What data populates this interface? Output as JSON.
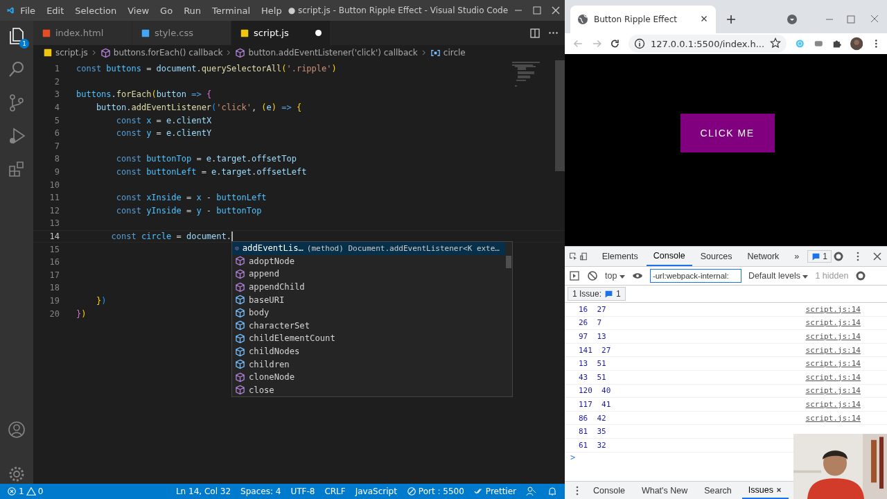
{
  "vscode": {
    "menu": [
      "File",
      "Edit",
      "Selection",
      "View",
      "Go",
      "Run",
      "Terminal",
      "Help"
    ],
    "title": "● script.js - Button Ripple Effect - Visual Studio Code",
    "explorer_badge": "1",
    "tabs": [
      {
        "label": "index.html",
        "kind": "html",
        "selected": false,
        "dirty": false
      },
      {
        "label": "style.css",
        "kind": "css",
        "selected": false,
        "dirty": false
      },
      {
        "label": "script.js",
        "kind": "js",
        "selected": true,
        "dirty": true
      }
    ],
    "breadcrumb": [
      {
        "label": "script.js",
        "kind": "file"
      },
      {
        "label": "buttons.forEach() callback",
        "kind": "method"
      },
      {
        "label": "button.addEventListener('click') callback",
        "kind": "method"
      },
      {
        "label": "circle",
        "kind": "variable"
      }
    ],
    "lines": [
      {
        "number": "1",
        "current": false,
        "tokens": [
          {
            "text": "const",
            "kind": "keyword"
          },
          {
            "text": " buttons",
            "kind": "constant"
          },
          {
            "text": " = ",
            "kind": "plain"
          },
          {
            "text": "document",
            "kind": "variable"
          },
          {
            "text": ".",
            "kind": "plain"
          },
          {
            "text": "querySelectorAll",
            "kind": "function"
          },
          {
            "text": "(",
            "kind": "bracket1"
          },
          {
            "text": "'.ripple'",
            "kind": "string"
          },
          {
            "text": ")",
            "kind": "bracket1"
          }
        ]
      },
      {
        "number": "2",
        "current": false
      },
      {
        "number": "3",
        "current": false,
        "tokens": [
          {
            "text": "buttons",
            "kind": "constant"
          },
          {
            "text": ".",
            "kind": "plain"
          },
          {
            "text": "forEach",
            "kind": "function"
          },
          {
            "text": "(",
            "kind": "bracket1"
          },
          {
            "text": "button",
            "kind": "variable"
          },
          {
            "text": " => ",
            "kind": "keyword"
          },
          {
            "text": "{",
            "kind": "bracket2"
          }
        ]
      },
      {
        "number": "4",
        "current": false,
        "tokens": [
          {
            "text": "    button",
            "kind": "variable"
          },
          {
            "text": ".",
            "kind": "plain"
          },
          {
            "text": "addEventListener",
            "kind": "function"
          },
          {
            "text": "(",
            "kind": "bracket3"
          },
          {
            "text": "'click'",
            "kind": "string"
          },
          {
            "text": ", ",
            "kind": "plain"
          },
          {
            "text": "(",
            "kind": "bracket1"
          },
          {
            "text": "e",
            "kind": "variable"
          },
          {
            "text": ")",
            "kind": "bracket1"
          },
          {
            "text": " => ",
            "kind": "keyword"
          },
          {
            "text": "{",
            "kind": "bracket1"
          }
        ]
      },
      {
        "number": "5",
        "current": false,
        "tokens": [
          {
            "text": "        const",
            "kind": "keyword"
          },
          {
            "text": " x",
            "kind": "constant"
          },
          {
            "text": " = ",
            "kind": "plain"
          },
          {
            "text": "e",
            "kind": "variable"
          },
          {
            "text": ".",
            "kind": "plain"
          },
          {
            "text": "clientX",
            "kind": "variable"
          }
        ]
      },
      {
        "number": "6",
        "current": false,
        "tokens": [
          {
            "text": "        const",
            "kind": "keyword"
          },
          {
            "text": " y",
            "kind": "constant"
          },
          {
            "text": " = ",
            "kind": "plain"
          },
          {
            "text": "e",
            "kind": "variable"
          },
          {
            "text": ".",
            "kind": "plain"
          },
          {
            "text": "clientY",
            "kind": "variable"
          }
        ]
      },
      {
        "number": "7",
        "current": false
      },
      {
        "number": "8",
        "current": false,
        "tokens": [
          {
            "text": "        const",
            "kind": "keyword"
          },
          {
            "text": " buttonTop",
            "kind": "constant"
          },
          {
            "text": " = ",
            "kind": "plain"
          },
          {
            "text": "e",
            "kind": "variable"
          },
          {
            "text": ".",
            "kind": "plain"
          },
          {
            "text": "target",
            "kind": "variable"
          },
          {
            "text": ".",
            "kind": "plain"
          },
          {
            "text": "offsetTop",
            "kind": "variable"
          }
        ]
      },
      {
        "number": "9",
        "current": false,
        "tokens": [
          {
            "text": "        const",
            "kind": "keyword"
          },
          {
            "text": " buttonLeft",
            "kind": "constant"
          },
          {
            "text": " = ",
            "kind": "plain"
          },
          {
            "text": "e",
            "kind": "variable"
          },
          {
            "text": ".",
            "kind": "plain"
          },
          {
            "text": "target",
            "kind": "variable"
          },
          {
            "text": ".",
            "kind": "plain"
          },
          {
            "text": "offsetLeft",
            "kind": "variable"
          }
        ]
      },
      {
        "number": "10",
        "current": false
      },
      {
        "number": "11",
        "current": false,
        "tokens": [
          {
            "text": "        const",
            "kind": "keyword"
          },
          {
            "text": " xInside",
            "kind": "constant"
          },
          {
            "text": " = ",
            "kind": "plain"
          },
          {
            "text": "x",
            "kind": "constant"
          },
          {
            "text": " - ",
            "kind": "plain"
          },
          {
            "text": "buttonLeft",
            "kind": "constant"
          }
        ]
      },
      {
        "number": "12",
        "current": false,
        "tokens": [
          {
            "text": "        const",
            "kind": "keyword"
          },
          {
            "text": " yInside",
            "kind": "constant"
          },
          {
            "text": " = ",
            "kind": "plain"
          },
          {
            "text": "y",
            "kind": "constant"
          },
          {
            "text": " - ",
            "kind": "plain"
          },
          {
            "text": "buttonTop",
            "kind": "constant"
          }
        ]
      },
      {
        "number": "13",
        "current": false
      },
      {
        "number": "14",
        "current": true,
        "tokens": [
          {
            "text": "       const",
            "kind": "keyword"
          },
          {
            "text": " circle",
            "kind": "constant"
          },
          {
            "text": " = ",
            "kind": "plain"
          },
          {
            "text": "document",
            "kind": "variable"
          },
          {
            "text": ".",
            "kind": "plain"
          }
        ]
      },
      {
        "number": "15",
        "current": false
      },
      {
        "number": "16",
        "current": false
      },
      {
        "number": "17",
        "current": false
      },
      {
        "number": "18",
        "current": false
      },
      {
        "number": "19",
        "current": false,
        "tokens": [
          {
            "text": "    }",
            "kind": "bracket1"
          },
          {
            "text": ")",
            "kind": "bracket3"
          }
        ]
      },
      {
        "number": "20",
        "current": false,
        "tokens": [
          {
            "text": "}",
            "kind": "bracket2"
          },
          {
            "text": ")",
            "kind": "bracket1"
          }
        ]
      }
    ],
    "suggestions": [
      {
        "label": "addEventLis…",
        "kind": "method",
        "selected": true,
        "detail": "(method) Document.addEventListener<K exte…"
      },
      {
        "label": "adoptNode",
        "kind": "method",
        "selected": false
      },
      {
        "label": "append",
        "kind": "method",
        "selected": false
      },
      {
        "label": "appendChild",
        "kind": "method",
        "selected": false
      },
      {
        "label": "baseURI",
        "kind": "property",
        "selected": false
      },
      {
        "label": "body",
        "kind": "property",
        "selected": false
      },
      {
        "label": "characterSet",
        "kind": "property",
        "selected": false
      },
      {
        "label": "childElementCount",
        "kind": "property",
        "selected": false
      },
      {
        "label": "childNodes",
        "kind": "property",
        "selected": false
      },
      {
        "label": "children",
        "kind": "property",
        "selected": false
      },
      {
        "label": "cloneNode",
        "kind": "method",
        "selected": false
      },
      {
        "label": "close",
        "kind": "method",
        "selected": false
      }
    ],
    "status_bar": {
      "errors": "1",
      "warnings": "0",
      "items": [
        "Ln 14, Col 32",
        "Spaces: 4",
        "UTF-8",
        "CRLF",
        "JavaScript"
      ],
      "port": "Port : 5500",
      "formatter": "Prettier"
    }
  },
  "browser": {
    "tab_title": "Button Ripple Effect",
    "url": "127.0.0.1:5500/index.h...",
    "page_button": "CLICK ME",
    "devtools": {
      "tabs": [
        {
          "label": "Elements",
          "selected": false
        },
        {
          "label": "Console",
          "selected": true
        },
        {
          "label": "Sources",
          "selected": false
        },
        {
          "label": "Network",
          "selected": false
        }
      ],
      "more": "»",
      "issues_badge": "1",
      "context": "top",
      "filter": "-url:webpack-internal:",
      "levels": "Default levels",
      "hidden": "1 hidden",
      "issues_label": "1 Issue:",
      "issues_count": "1",
      "logs": [
        {
          "text": "16  27",
          "source": "script.js:14"
        },
        {
          "text": "26  7",
          "source": "script.js:14"
        },
        {
          "text": "97  13",
          "source": "script.js:14"
        },
        {
          "text": "141  27",
          "source": "script.js:14"
        },
        {
          "text": "13  51",
          "source": "script.js:14"
        },
        {
          "text": "43  51",
          "source": "script.js:14"
        },
        {
          "text": "120  40",
          "source": "script.js:14"
        },
        {
          "text": "117  41",
          "source": "script.js:14"
        },
        {
          "text": "86  42",
          "source": "script.js:14"
        },
        {
          "text": "81  35"
        },
        {
          "text": "61  32"
        }
      ],
      "prompt": ">",
      "drawer_tabs": [
        {
          "label": "Console",
          "selected": false,
          "closable": false
        },
        {
          "label": "What's New",
          "selected": false,
          "closable": false
        },
        {
          "label": "Search",
          "selected": false,
          "closable": false
        },
        {
          "label": "Issues",
          "selected": true,
          "closable": true
        }
      ]
    }
  }
}
